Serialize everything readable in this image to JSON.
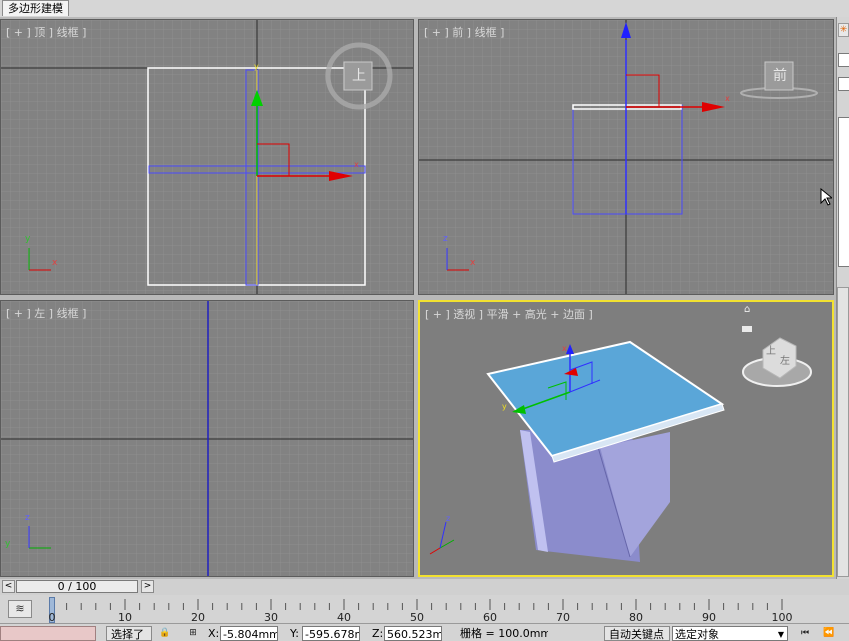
{
  "ribbon": {
    "tab_label": "多边形建模"
  },
  "viewports": {
    "top": {
      "label": "[ + ] 顶 ] 线框 ]",
      "viewcube_face": "上"
    },
    "front": {
      "label": "[ + ] 前 ] 线框 ]",
      "viewcube_face": "前"
    },
    "left": {
      "label": "[ + ] 左 ] 线框 ]"
    },
    "perspective": {
      "label": "[ + ] 透视 ] 平滑 + 高光 + 边面 ]",
      "viewcube_faces": [
        "上",
        "左"
      ]
    }
  },
  "axis_labels": {
    "x": "x",
    "y": "y",
    "z": "z"
  },
  "time_slider": {
    "position_text": "0 / 100",
    "prev": "<",
    "next": ">"
  },
  "track_bar": {
    "ticks": [
      "0",
      "10",
      "20",
      "30",
      "40",
      "50",
      "60",
      "70",
      "80",
      "90",
      "100"
    ]
  },
  "status_bar": {
    "select_button": "选择了",
    "x_label": "X:",
    "x_value": "-5.804mm",
    "y_label": "Y:",
    "y_value": "-595.678m",
    "z_label": "Z:",
    "z_value": "560.523mm",
    "grid_text": "栅格 = 100.0mm",
    "auto_key": "自动关键点",
    "selection_set": "选定对象"
  },
  "colors": {
    "active_viewport": "#f2e130",
    "viewport_bg": "#828282",
    "box_top": "#6fa8d8",
    "box_side": "#8a8ad0"
  }
}
